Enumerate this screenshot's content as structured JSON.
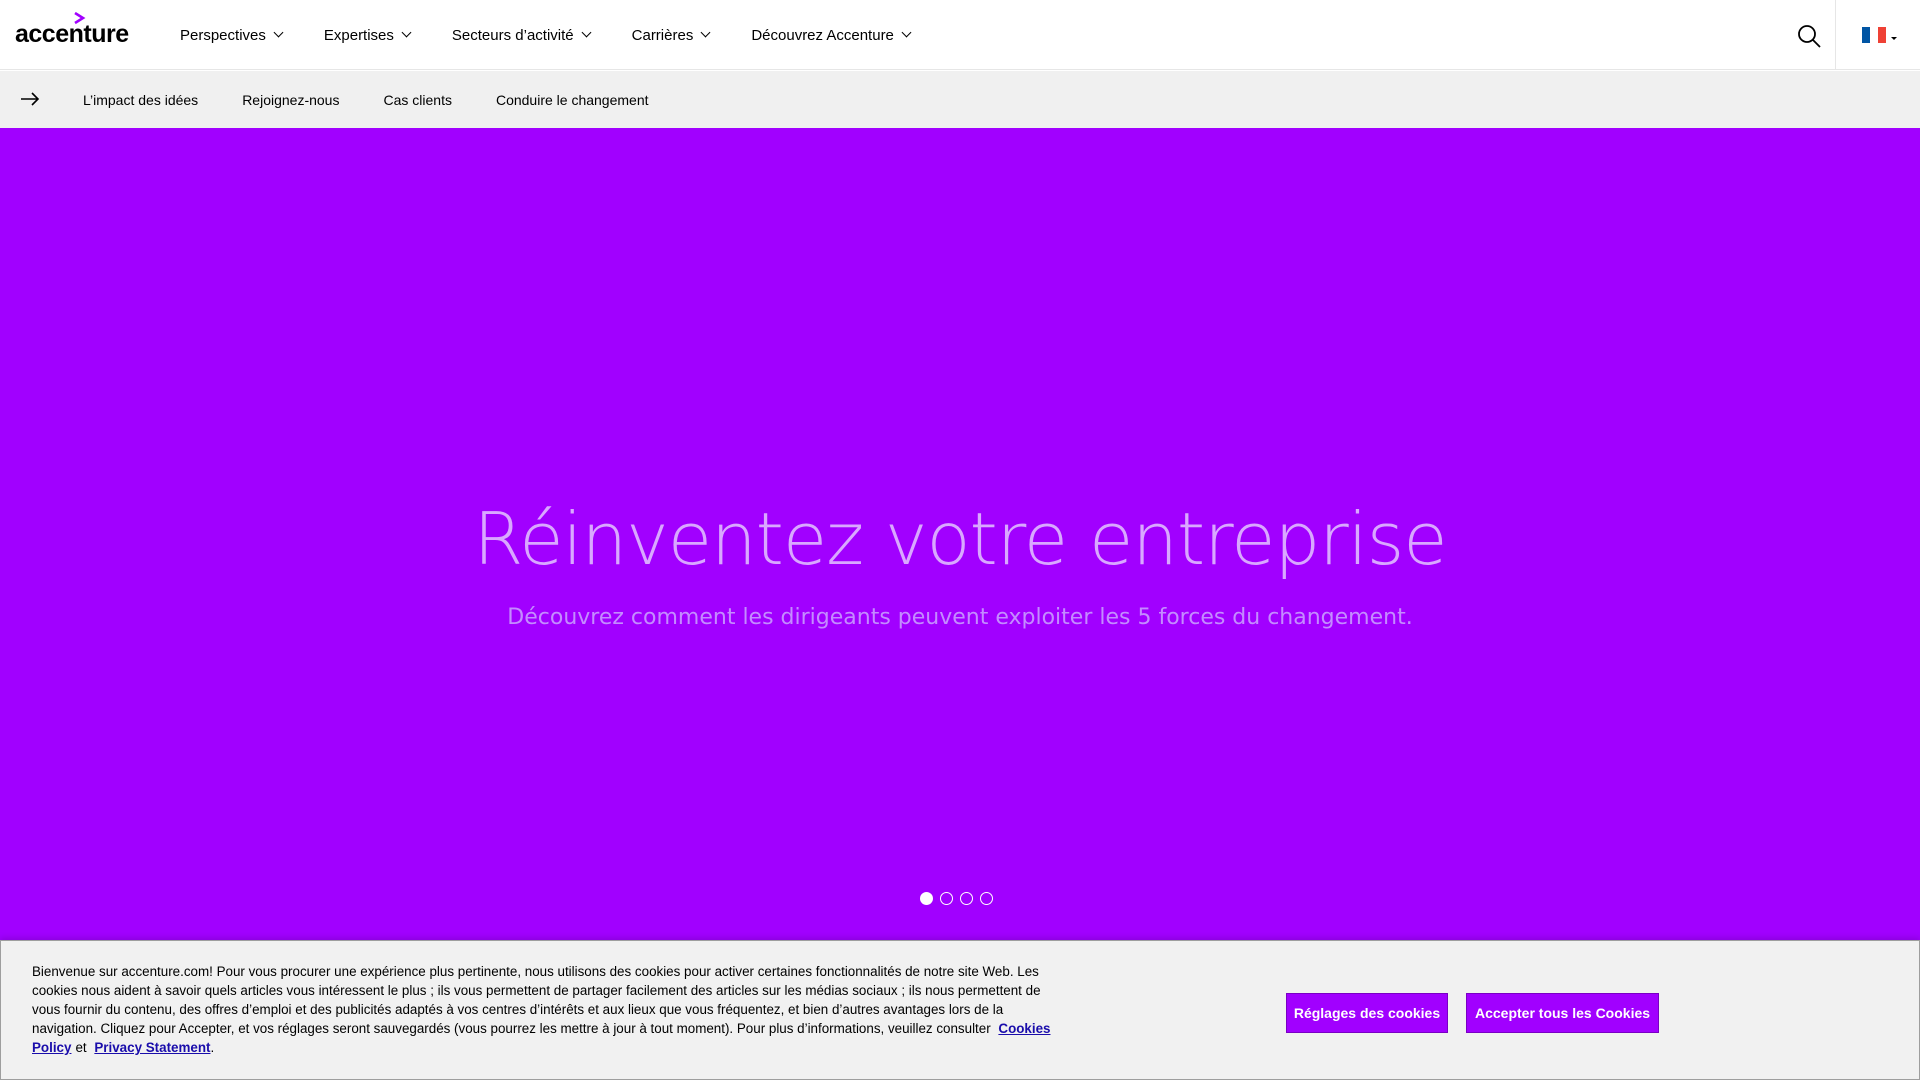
{
  "brand": {
    "name": "accenture",
    "accent_color": "#a100ff"
  },
  "topnav": {
    "menu": [
      {
        "label": "Perspectives"
      },
      {
        "label": "Expertises"
      },
      {
        "label": "Secteurs d’activité"
      },
      {
        "label": "Carrières"
      },
      {
        "label": "Découvrez Accenture"
      }
    ],
    "search_icon": "search-icon",
    "language_icon": "france-flag-icon",
    "flag_colors": [
      "#0055a4",
      "#ffffff",
      "#ef4135"
    ]
  },
  "subnav": {
    "arrow_icon": "arrow-right-icon",
    "links": [
      {
        "label": "L’impact des idées"
      },
      {
        "label": "Rejoignez-nous"
      },
      {
        "label": "Cas clients"
      },
      {
        "label": "Conduire le changement"
      }
    ]
  },
  "hero": {
    "background_color": "#a100ff",
    "title": "Réinventez votre entreprise",
    "subtitle": "Découvrez comment les dirigeants peuvent exploiter les 5 forces du changement.",
    "carousel": {
      "total_slides": 4,
      "active_slide": 1
    }
  },
  "cookie_banner": {
    "text": "Bienvenue sur accenture.com! Pour vous procurer une expérience plus pertinente, nous utilisons des cookies pour activer certaines fonctionnalités de notre site Web. Les cookies nous aident à savoir quels articles vous intéressent le plus ; ils vous permettent de partager facilement des articles sur les médias sociaux ; ils nous permettent de vous fournir du contenu, des offres d’emploi et des publicités adaptés à vos centres d’intérêts et aux lieux que vous fréquentez, et bien d’autres avantages lors de la navigation. Cliquez pour Accepter, et vos réglages seront sauvegardés (vous pourrez les mettre à jour à tout moment). Pour plus d’informations, veuillez consulter",
    "link_cookies": "Cookies Policy",
    "connector": "et",
    "link_privacy": "Privacy Statement",
    "end": ".",
    "settings_button": "Réglages des cookies",
    "accept_button": "Accepter tous les Cookies"
  }
}
